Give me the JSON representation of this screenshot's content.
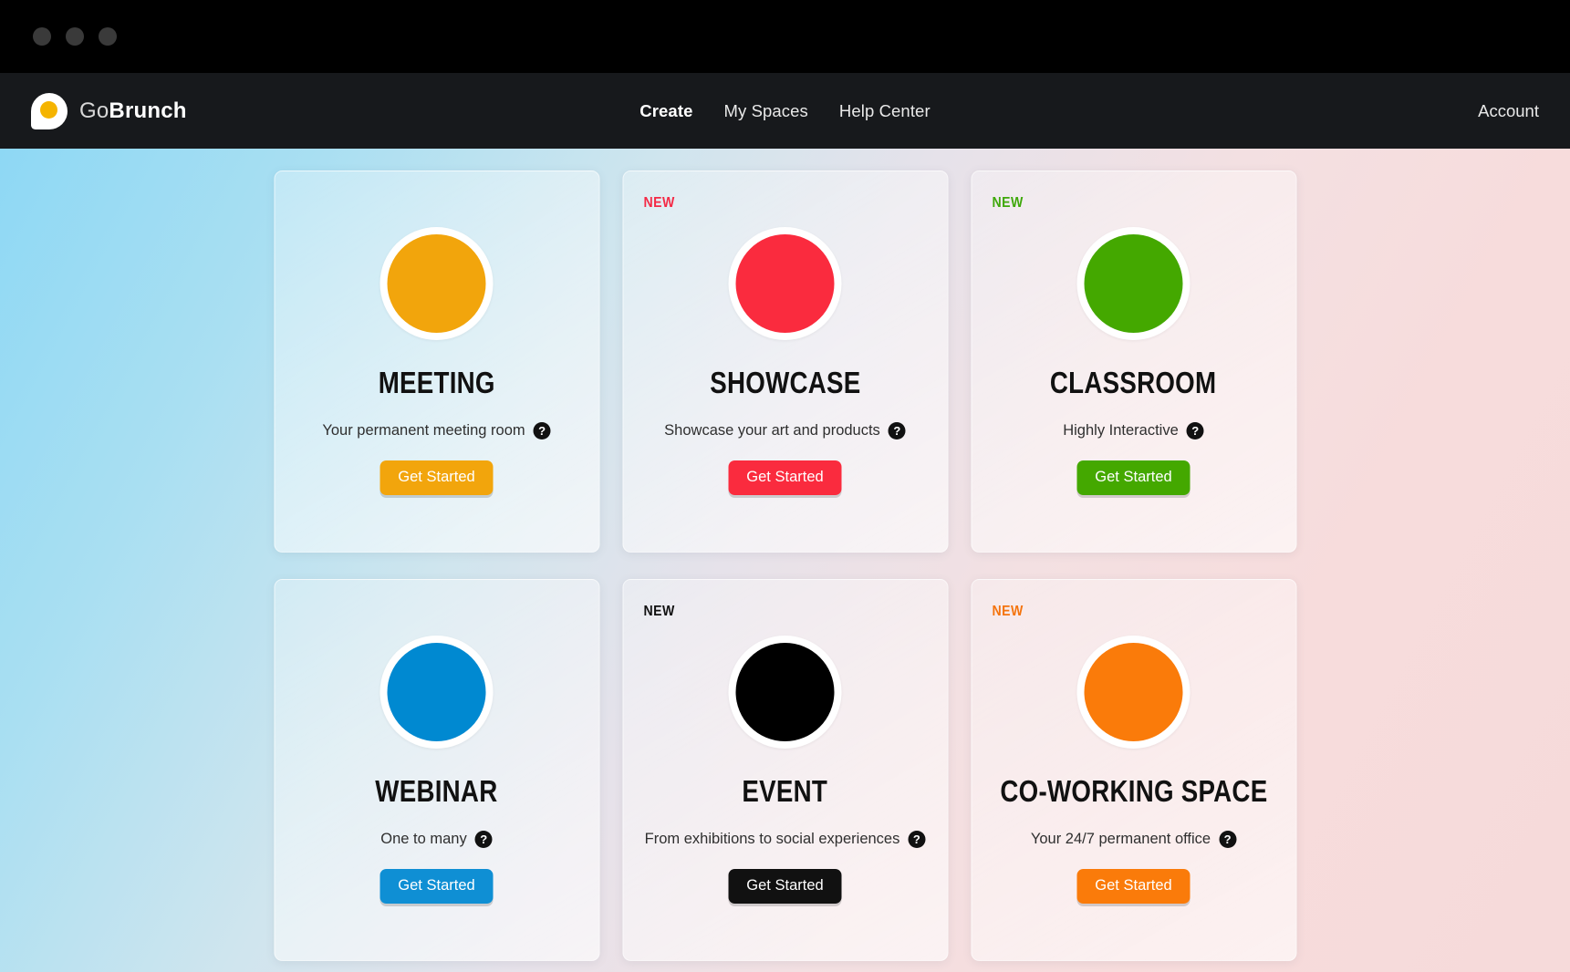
{
  "window": {
    "traffic_lights": [
      "close",
      "minimize",
      "maximize"
    ]
  },
  "navbar": {
    "brand_go": "Go",
    "brand_brunch": "Brunch",
    "links": [
      {
        "label": "Create",
        "active": true
      },
      {
        "label": "My Spaces",
        "active": false
      },
      {
        "label": "Help Center",
        "active": false
      }
    ],
    "account_label": "Account"
  },
  "cards": [
    {
      "id": "meeting",
      "title": "MEETING",
      "subtitle": "Your permanent meeting room",
      "cta_label": "Get Started",
      "badge": null,
      "badge_color": null,
      "circle_color": "#F2A50C",
      "button_color": "#F2A50C",
      "button_text_color": "#FFFFFF",
      "help_icon": "question-mark-icon"
    },
    {
      "id": "showcase",
      "title": "SHOWCASE",
      "subtitle": "Showcase your art and products",
      "cta_label": "Get Started",
      "badge": "NEW",
      "badge_color": "#F42A46",
      "circle_color": "#FA2B3E",
      "button_color": "#FA2B3E",
      "button_text_color": "#FFFFFF",
      "help_icon": "question-mark-icon"
    },
    {
      "id": "classroom",
      "title": "CLASSROOM",
      "subtitle": "Highly Interactive",
      "cta_label": "Get Started",
      "badge": "NEW",
      "badge_color": "#3FA80B",
      "circle_color": "#44A800",
      "button_color": "#44A800",
      "button_text_color": "#FFFFFF",
      "help_icon": "question-mark-icon"
    },
    {
      "id": "webinar",
      "title": "WEBINAR",
      "subtitle": "One to many",
      "cta_label": "Get Started",
      "badge": null,
      "badge_color": null,
      "circle_color": "#0089D1",
      "button_color": "#0F8FD4",
      "button_text_color": "#FFFFFF",
      "help_icon": "question-mark-icon"
    },
    {
      "id": "event",
      "title": "EVENT",
      "subtitle": "From exhibitions to social experiences",
      "cta_label": "Get Started",
      "badge": "NEW",
      "badge_color": "#111111",
      "circle_color": "#000000",
      "button_color": "#111111",
      "button_text_color": "#FFFFFF",
      "help_icon": "question-mark-icon"
    },
    {
      "id": "co-working-space",
      "title": "CO-WORKING SPACE",
      "subtitle": "Your 24/7 permanent office",
      "cta_label": "Get Started",
      "badge": "NEW",
      "badge_color": "#F4740E",
      "circle_color": "#FA7B0A",
      "button_color": "#FA7B0A",
      "button_text_color": "#FFFFFF",
      "help_icon": "question-mark-icon"
    }
  ],
  "theme": {
    "navbar_bg": "#17191C",
    "titlebar_bg": "#000000",
    "bg_gradient_start": "#8ED8F4",
    "bg_gradient_end": "#F6DADA",
    "logo_yolk": "#F5B400"
  }
}
